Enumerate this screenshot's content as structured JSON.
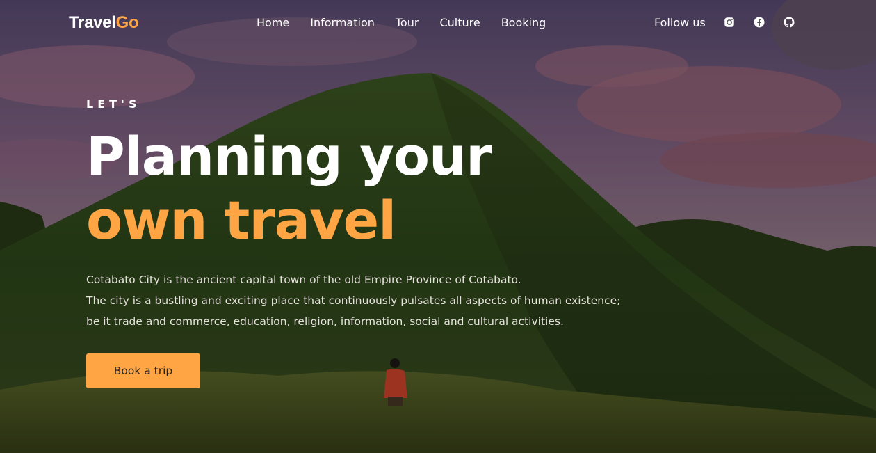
{
  "brand": {
    "name_part1": "Travel",
    "name_part2": "Go",
    "accent_color": "#ffa544"
  },
  "nav": {
    "items": [
      {
        "label": "Home"
      },
      {
        "label": "Information"
      },
      {
        "label": "Tour"
      },
      {
        "label": "Culture"
      },
      {
        "label": "Booking"
      }
    ]
  },
  "social": {
    "label": "Follow us",
    "icons": [
      "instagram-icon",
      "facebook-icon",
      "github-icon"
    ]
  },
  "hero": {
    "eyebrow": "LET'S",
    "headline_line1": "Planning your",
    "headline_line2": "own travel",
    "description_lines": [
      "Cotabato City is the ancient capital town of the old Empire Province of Cotabato.",
      "The city is a bustling and exciting place that continuously pulsates all aspects of human existence;",
      "be it trade and commerce, education, religion, information, social and cultural activities."
    ],
    "cta_label": "Book a trip"
  }
}
